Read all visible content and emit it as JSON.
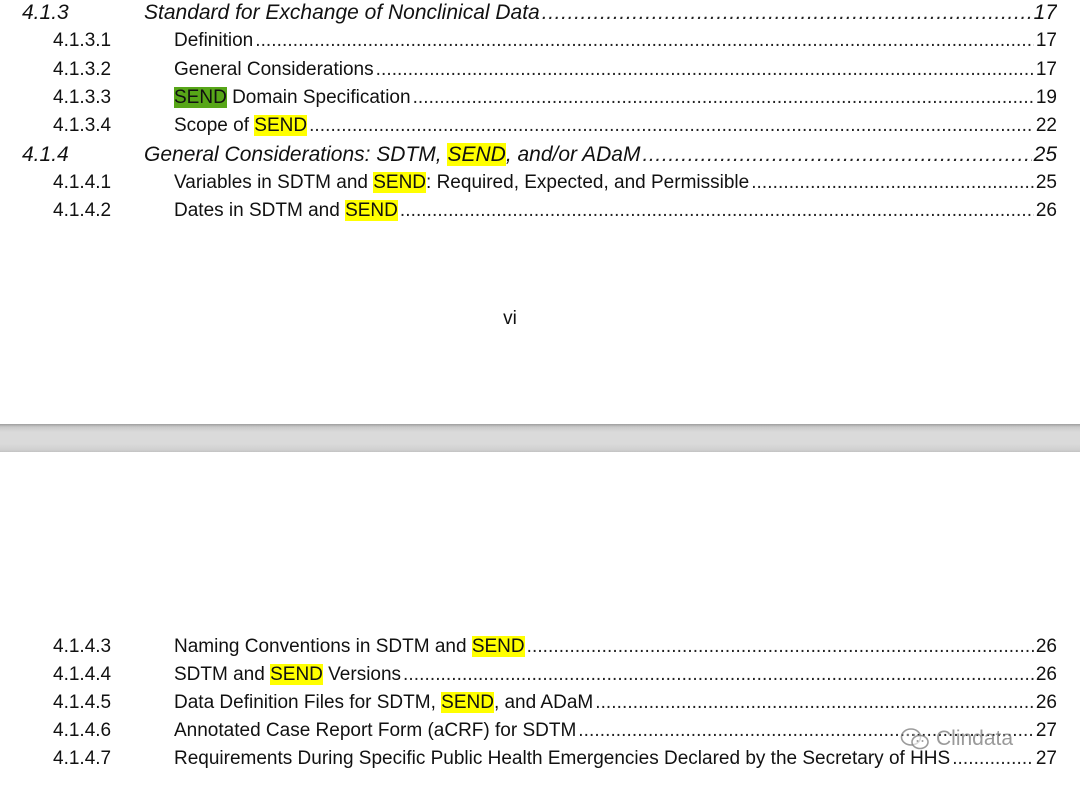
{
  "toc_top": [
    {
      "level": 1,
      "num": "4.1.3",
      "parts": [
        {
          "t": "Standard for Exchange of Nonclinical Data",
          "hl": ""
        }
      ],
      "page": "17"
    },
    {
      "level": 2,
      "num": "4.1.3.1",
      "parts": [
        {
          "t": "Definition",
          "hl": ""
        }
      ],
      "page": "17"
    },
    {
      "level": 2,
      "num": "4.1.3.2",
      "parts": [
        {
          "t": "General Considerations",
          "hl": ""
        }
      ],
      "page": "17"
    },
    {
      "level": 2,
      "num": "4.1.3.3",
      "parts": [
        {
          "t": "SEND",
          "hl": "green"
        },
        {
          "t": " Domain Specification",
          "hl": ""
        }
      ],
      "page": "19"
    },
    {
      "level": 2,
      "num": "4.1.3.4",
      "parts": [
        {
          "t": "Scope of ",
          "hl": ""
        },
        {
          "t": "SEND",
          "hl": "yellow"
        }
      ],
      "page": "22"
    },
    {
      "level": 1,
      "num": "4.1.4",
      "parts": [
        {
          "t": "General Considerations: SDTM, ",
          "hl": ""
        },
        {
          "t": "SEND",
          "hl": "yellow"
        },
        {
          "t": ", and/or ADaM",
          "hl": ""
        }
      ],
      "page": "25"
    },
    {
      "level": 2,
      "num": "4.1.4.1",
      "parts": [
        {
          "t": "Variables in SDTM and ",
          "hl": ""
        },
        {
          "t": "SEND",
          "hl": "yellow"
        },
        {
          "t": ": Required, Expected, and Permissible",
          "hl": ""
        }
      ],
      "page": "25"
    },
    {
      "level": 2,
      "num": "4.1.4.2",
      "parts": [
        {
          "t": "Dates in SDTM and ",
          "hl": ""
        },
        {
          "t": "SEND",
          "hl": "yellow"
        }
      ],
      "page": "26"
    }
  ],
  "page_number": "vi",
  "toc_bottom": [
    {
      "level": 2,
      "num": "4.1.4.3",
      "parts": [
        {
          "t": "Naming Conventions in SDTM and ",
          "hl": ""
        },
        {
          "t": "SEND",
          "hl": "yellow"
        }
      ],
      "page": "26"
    },
    {
      "level": 2,
      "num": "4.1.4.4",
      "parts": [
        {
          "t": "SDTM and ",
          "hl": ""
        },
        {
          "t": "SEND",
          "hl": "yellow"
        },
        {
          "t": " Versions",
          "hl": ""
        }
      ],
      "page": "26"
    },
    {
      "level": 2,
      "num": "4.1.4.5",
      "parts": [
        {
          "t": "Data Definition Files for SDTM, ",
          "hl": ""
        },
        {
          "t": "SEND",
          "hl": "yellow"
        },
        {
          "t": ", and ADaM",
          "hl": ""
        }
      ],
      "page": "26"
    },
    {
      "level": 2,
      "num": "4.1.4.6",
      "parts": [
        {
          "t": "Annotated Case Report Form (aCRF) for SDTM",
          "hl": ""
        }
      ],
      "page": "27"
    },
    {
      "level": 2,
      "num": "4.1.4.7",
      "parts": [
        {
          "t": "Requirements During Specific Public Health Emergencies Declared by the Secretary of HHS",
          "hl": ""
        }
      ],
      "page": "27"
    }
  ],
  "watermark": {
    "text": "Clindata",
    "icon": "wechat-icon"
  },
  "colors": {
    "highlight_yellow": "#ffff00",
    "highlight_green": "#57a618"
  }
}
